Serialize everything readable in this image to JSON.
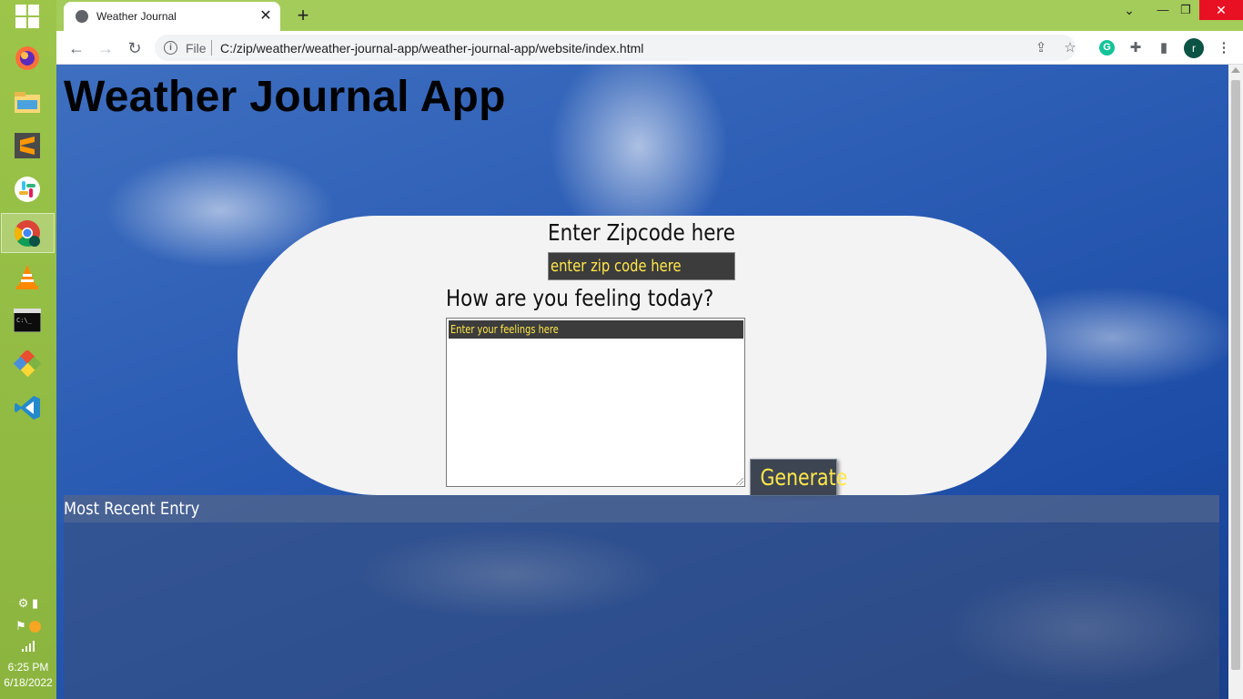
{
  "taskbar": {
    "icons": [
      "windows-start-icon",
      "firefox-icon",
      "file-explorer-icon",
      "sublime-text-icon",
      "slack-icon",
      "chrome-icon",
      "vlc-icon",
      "terminal-icon",
      "git-icon",
      "vscode-icon"
    ],
    "clock": {
      "time": "6:25 PM",
      "date": "6/18/2022"
    }
  },
  "browser": {
    "tab_title": "Weather Journal",
    "tab_close": "✕",
    "new_tab": "+",
    "file_label": "File",
    "url": "C:/zip/weather/weather-journal-app/weather-journal-app/website/index.html",
    "profile_initial": "r",
    "grammarly_letter": "G"
  },
  "page": {
    "title": "Weather Journal App",
    "zip_label": "Enter Zipcode here",
    "zip_placeholder": "enter zip code here",
    "feelings_label": "How are you feeling today?",
    "feelings_placeholder": "Enter your feelings here",
    "generate_label": "Generate",
    "entry_title": "Most Recent Entry"
  },
  "colors": {
    "accent_yellow": "#ffe74a",
    "input_dark": "#3c3c3c",
    "button_bg": "#3d4552",
    "taskbar_green": "#9cc54a",
    "tabstrip_green": "#a4cc5a"
  }
}
